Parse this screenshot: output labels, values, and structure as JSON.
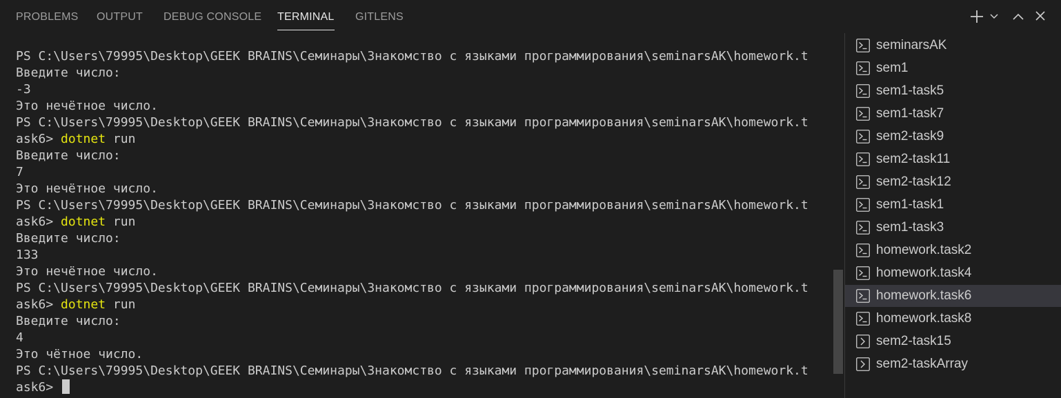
{
  "tabs": [
    {
      "label": "PROBLEMS"
    },
    {
      "label": "OUTPUT"
    },
    {
      "label": "DEBUG CONSOLE"
    },
    {
      "label": "TERMINAL",
      "active": true
    },
    {
      "label": "GITLENS"
    }
  ],
  "toolbar": {
    "icons": [
      "plus-icon",
      "chevron-down-icon",
      "chevron-up-icon",
      "close-icon"
    ]
  },
  "terminal": {
    "lines": [
      {
        "text": "PS C:\\Users\\79995\\Desktop\\GEEK BRAINS\\Семинары\\Знакомство с языками программирования\\seminarsAK\\homework.t"
      },
      {
        "text": "Введите число:"
      },
      {
        "text": "-3"
      },
      {
        "text": "Это нечётное число."
      },
      {
        "text": "PS C:\\Users\\79995\\Desktop\\GEEK BRAINS\\Семинары\\Знакомство с языками программирования\\seminarsAK\\homework.t"
      },
      {
        "prefix": "ask6> ",
        "cmd": "dotnet",
        "rest": " run"
      },
      {
        "text": "Введите число:"
      },
      {
        "text": "7"
      },
      {
        "text": "Это нечётное число."
      },
      {
        "text": "PS C:\\Users\\79995\\Desktop\\GEEK BRAINS\\Семинары\\Знакомство с языками программирования\\seminarsAK\\homework.t"
      },
      {
        "prefix": "ask6> ",
        "cmd": "dotnet",
        "rest": " run"
      },
      {
        "text": "Введите число:"
      },
      {
        "text": "133"
      },
      {
        "text": "Это нечётное число."
      },
      {
        "text": "PS C:\\Users\\79995\\Desktop\\GEEK BRAINS\\Семинары\\Знакомство с языками программирования\\seminarsAK\\homework.t"
      },
      {
        "prefix": "ask6> ",
        "cmd": "dotnet",
        "rest": " run"
      },
      {
        "text": "Введите число:"
      },
      {
        "text": "4"
      },
      {
        "text": "Это чётное число."
      },
      {
        "text": "PS C:\\Users\\79995\\Desktop\\GEEK BRAINS\\Семинары\\Знакомство с языками программирования\\seminarsAK\\homework.t"
      },
      {
        "prefix": "ask6> ",
        "cursor": true
      }
    ]
  },
  "terminal_list": {
    "items": [
      {
        "label": "seminarsAK"
      },
      {
        "label": "sem1"
      },
      {
        "label": "sem1-task5"
      },
      {
        "label": "sem1-task7"
      },
      {
        "label": "sem2-task9"
      },
      {
        "label": "sem2-task11"
      },
      {
        "label": "sem2-task12"
      },
      {
        "label": "sem1-task1"
      },
      {
        "label": "sem1-task3"
      },
      {
        "label": "homework.task2"
      },
      {
        "label": "homework.task4"
      },
      {
        "label": "homework.task6",
        "selected": true
      },
      {
        "label": "homework.task8"
      },
      {
        "label": "sem2-task15",
        "icon": "chevron-right-icon"
      },
      {
        "label": "sem2-taskArray",
        "icon": "chevron-right-icon"
      }
    ]
  }
}
